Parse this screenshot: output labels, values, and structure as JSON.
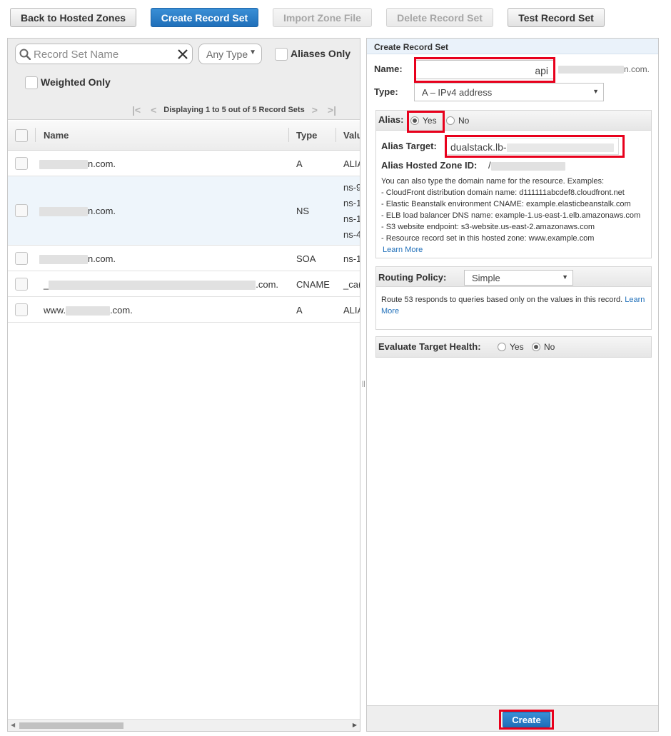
{
  "toolbar": {
    "back": "Back to Hosted Zones",
    "create": "Create Record Set",
    "import": "Import Zone File",
    "delete": "Delete Record Set",
    "test": "Test Record Set"
  },
  "filter": {
    "search_placeholder": "Record Set Name",
    "type_value": "Any Type",
    "aliases_only": "Aliases Only",
    "weighted_only": "Weighted Only",
    "pager_text": "Displaying 1 to 5 out of 5 Record Sets"
  },
  "grid": {
    "headers": {
      "name": "Name",
      "type": "Type",
      "value": "Valu"
    },
    "rows": [
      {
        "name_suffix": "n.com.",
        "type": "A",
        "value": [
          "ALIA"
        ]
      },
      {
        "name_suffix": "n.com.",
        "type": "NS",
        "value": [
          "ns-9",
          "ns-1",
          "ns-1",
          "ns-4"
        ]
      },
      {
        "name_suffix": "n.com.",
        "type": "SOA",
        "value": [
          "ns-1"
        ]
      },
      {
        "name_prefix": "_",
        "name_suffix": ".com.",
        "type": "CNAME",
        "value": [
          "_ca("
        ]
      },
      {
        "name_prefix": "www.",
        "name_suffix": ".com.",
        "type": "A",
        "value": [
          "ALIA"
        ]
      }
    ]
  },
  "form": {
    "title": "Create Record Set",
    "name_label": "Name:",
    "name_value": "api",
    "domain_suffix": "n.com.",
    "type_label": "Type:",
    "type_value": "A – IPv4 address",
    "alias_label": "Alias:",
    "alias_yes": "Yes",
    "alias_no": "No",
    "alias_selected": "Yes",
    "alias_target_label": "Alias Target:",
    "alias_target_value": "dualstack.lb-",
    "alias_zone_label": "Alias Hosted Zone ID:",
    "alias_zone_value": "/",
    "help_intro": "You can also type the domain name for the resource. Examples:",
    "help_lines": [
      "-  CloudFront distribution domain name: d111111abcdef8.cloudfront.net",
      "-  Elastic Beanstalk environment CNAME: example.elasticbeanstalk.com",
      "-  ELB load balancer DNS name: example-1.us-east-1.elb.amazonaws.com",
      "-  S3 website endpoint: s3-website.us-east-2.amazonaws.com",
      "-  Resource record set in this hosted zone: www.example.com"
    ],
    "learn_more": "Learn More",
    "routing_label": "Routing Policy:",
    "routing_value": "Simple",
    "routing_help": "Route 53 responds to queries based only on the values in this record.",
    "routing_learn": "Learn",
    "routing_more": "More",
    "eval_label": "Evaluate Target Health:",
    "eval_yes": "Yes",
    "eval_no": "No",
    "eval_selected": "No",
    "create_label": "Create"
  },
  "colors": {
    "primary": "#1f6fb9",
    "highlight": "#e8001c",
    "link": "#1f6fb9"
  }
}
